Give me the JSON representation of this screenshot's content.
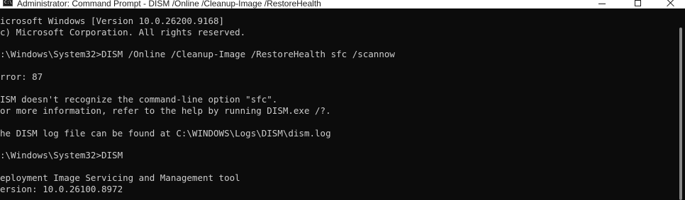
{
  "window": {
    "title": "Administrator: Command Prompt - DISM  /Online /Cleanup-Image /RestoreHealth",
    "icon": "terminal-icon",
    "icon_glyph": "C:\\",
    "controls": {
      "minimize": "minimize-icon",
      "maximize": "maximize-icon",
      "close": "close-icon"
    }
  },
  "console": {
    "background": "#0c0c0c",
    "foreground": "#cccccc",
    "lines": [
      "icrosoft Windows [Version 10.0.26200.9168]",
      "c) Microsoft Corporation. All rights reserved.",
      "",
      ":\\Windows\\System32>DISM /Online /Cleanup-Image /RestoreHealth sfc /scannow",
      "",
      "rror: 87",
      "",
      "ISM doesn't recognize the command-line option \"sfc\".",
      "or more information, refer to the help by running DISM.exe /?.",
      "",
      "he DISM log file can be found at C:\\WINDOWS\\Logs\\DISM\\dism.log",
      "",
      ":\\Windows\\System32>DISM",
      "",
      "eployment Image Servicing and Management tool",
      "ersion: 10.0.26100.8972"
    ]
  }
}
